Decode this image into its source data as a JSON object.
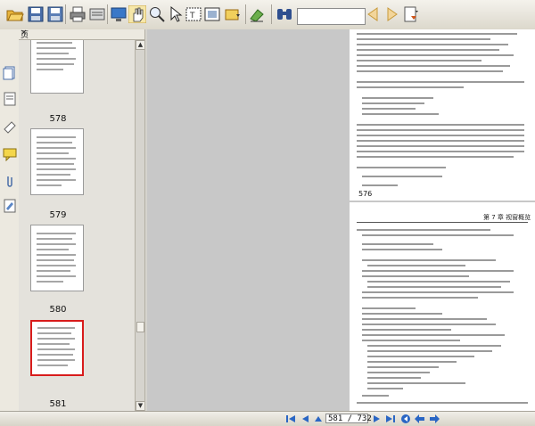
{
  "toolbar": {
    "buttons": [
      "open-folder-icon",
      "save-icon",
      "save-as-icon",
      "print-icon",
      "print-setup-icon",
      "fullscreen-icon",
      "hand-tool-icon",
      "zoom-tool-icon",
      "select-tool-icon",
      "snapshot-icon",
      "image-select-icon",
      "fit-page-icon",
      "eraser-icon",
      "binoculars-icon",
      "prev-result-icon",
      "next-result-icon",
      "bookmark-icon"
    ],
    "search_value": ""
  },
  "sidebar": {
    "tab_label": "页",
    "close_label": "×",
    "tabs": [
      "pages-icon",
      "outline-icon",
      "attachments-icon",
      "comments-icon",
      "paperclip-icon",
      "signature-icon"
    ],
    "pages": [
      {
        "label": "578",
        "selected": false
      },
      {
        "label": "579",
        "selected": false
      },
      {
        "label": "580",
        "selected": false
      },
      {
        "label": "581",
        "selected": true
      }
    ]
  },
  "document": {
    "page1_number": "576",
    "page2_header": "第 7 章   视窗概览"
  },
  "status": {
    "page_indicator": "581 / 732"
  },
  "colors": {
    "selection_border": "#d81c1c",
    "toolbar_bg": "#e8e5dc"
  }
}
